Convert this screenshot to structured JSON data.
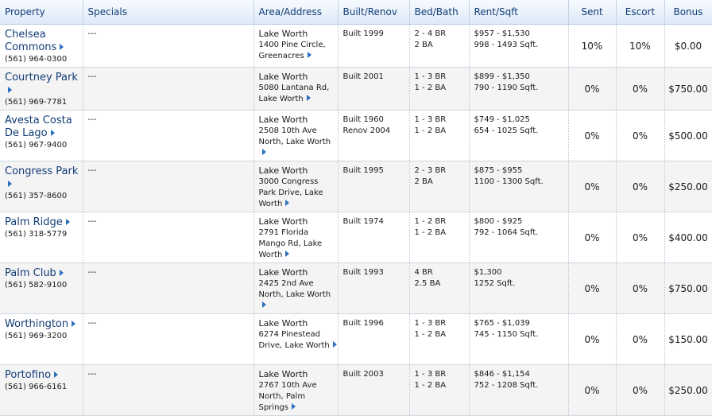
{
  "columns": {
    "property": "Property",
    "specials": "Specials",
    "area": "Area/Address",
    "built": "Built/Renov",
    "bed": "Bed/Bath",
    "rent": "Rent/Sqft",
    "sent": "Sent",
    "escort": "Escort",
    "bonus": "Bonus"
  },
  "rows": [
    {
      "name": "Chelsea Commons",
      "phone": "(561) 964-0300",
      "specials": "---",
      "area": "Lake Worth",
      "address": "1400 Pine Circle, Greenacres",
      "built": [
        "Built 1999"
      ],
      "bed": "2 - 4 BR",
      "bath": "2 BA",
      "rent": "$957 - $1,530",
      "sqft": "998 - 1493 Sqft.",
      "sent": "10%",
      "escort": "10%",
      "bonus": "$0.00"
    },
    {
      "name": "Courtney Park",
      "phone": "(561) 969-7781",
      "specials": "---",
      "area": "Lake Worth",
      "address": "5080 Lantana Rd, Lake Worth",
      "built": [
        "Built 2001"
      ],
      "bed": "1 - 3 BR",
      "bath": "1 - 2 BA",
      "rent": "$899 - $1,350",
      "sqft": "790 - 1190 Sqft.",
      "sent": "0%",
      "escort": "0%",
      "bonus": "$750.00"
    },
    {
      "name": "Avesta Costa De Lago",
      "phone": "(561) 967-9400",
      "specials": "---",
      "area": "Lake Worth",
      "address": "2508 10th Ave North, Lake Worth",
      "built": [
        "Built 1960",
        "Renov 2004"
      ],
      "bed": "1 - 3 BR",
      "bath": "1 - 2 BA",
      "rent": "$749 - $1,025",
      "sqft": "654 - 1025 Sqft.",
      "sent": "0%",
      "escort": "0%",
      "bonus": "$500.00"
    },
    {
      "name": "Congress Park",
      "phone": "(561) 357-8600",
      "specials": "---",
      "area": "Lake Worth",
      "address": "3000 Congress Park Drive, Lake Worth",
      "built": [
        "Built 1995"
      ],
      "bed": "2 - 3 BR",
      "bath": "2 BA",
      "rent": "$875 - $955",
      "sqft": "1100 - 1300 Sqft.",
      "sent": "0%",
      "escort": "0%",
      "bonus": "$250.00"
    },
    {
      "name": "Palm Ridge",
      "phone": "(561) 318-5779",
      "specials": "---",
      "area": "Lake Worth",
      "address": "2791 Florida Mango Rd, Lake Worth",
      "built": [
        "Built 1974"
      ],
      "bed": "1 - 2 BR",
      "bath": "1 - 2 BA",
      "rent": "$800 - $925",
      "sqft": "792 - 1064 Sqft.",
      "sent": "0%",
      "escort": "0%",
      "bonus": "$400.00"
    },
    {
      "name": "Palm Club",
      "phone": "(561) 582-9100",
      "specials": "---",
      "area": "Lake Worth",
      "address": "2425 2nd Ave North, Lake Worth",
      "built": [
        "Built 1993"
      ],
      "bed": "4 BR",
      "bath": "2.5 BA",
      "rent": "$1,300",
      "sqft": "1252 Sqft.",
      "sent": "0%",
      "escort": "0%",
      "bonus": "$750.00"
    },
    {
      "name": "Worthington",
      "phone": "(561) 969-3200",
      "specials": "---",
      "area": "Lake Worth",
      "address": "6274 Pinestead Drive, Lake Worth",
      "built": [
        "Built 1996"
      ],
      "bed": "1 - 3 BR",
      "bath": "1 - 2 BA",
      "rent": "$765 - $1,039",
      "sqft": "745 - 1150 Sqft.",
      "sent": "0%",
      "escort": "0%",
      "bonus": "$150.00"
    },
    {
      "name": "Portofino",
      "phone": "(561) 966-6161",
      "specials": "---",
      "area": "Lake Worth",
      "address": "2767 10th Ave North, Palm Springs",
      "built": [
        "Built 2003"
      ],
      "bed": "1 - 3 BR",
      "bath": "1 - 2 BA",
      "rent": "$846 - $1,154",
      "sqft": "752 - 1208 Sqft.",
      "sent": "0%",
      "escort": "0%",
      "bonus": "$250.00"
    }
  ]
}
